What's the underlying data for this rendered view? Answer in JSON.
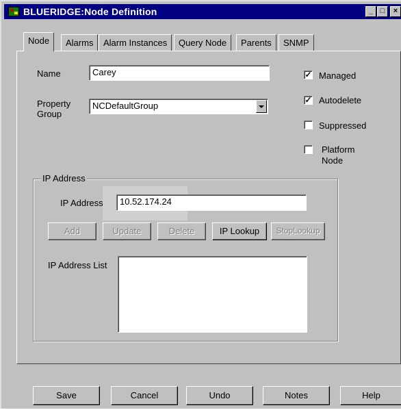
{
  "window": {
    "title": "BLUERIDGE:Node Definition",
    "controls": {
      "minimize": "_",
      "maximize": "□",
      "close": "×"
    }
  },
  "tabs": [
    {
      "label": "Node",
      "active": true
    },
    {
      "label": "Alarms"
    },
    {
      "label": "Alarm Instances"
    },
    {
      "label": "Query Node"
    },
    {
      "label": "Parents"
    },
    {
      "label": "SNMP"
    }
  ],
  "form": {
    "name_label": "Name",
    "name_value": "Carey",
    "property_group_label_line1": "Property",
    "property_group_label_line2": "Group",
    "property_group_value": "NCDefaultGroup"
  },
  "checkboxes": [
    {
      "label": "Managed",
      "checked": true
    },
    {
      "label": "Autodelete",
      "checked": true
    },
    {
      "label": "Suppressed",
      "checked": false
    },
    {
      "label_line1": "Platform",
      "label_line2": "Node",
      "checked": false
    }
  ],
  "ip_group": {
    "title": "IP Address",
    "ip_label": "IP Address",
    "ip_value": "10.52.174.24",
    "list_label": "IP Address List",
    "buttons": [
      {
        "label": "Add",
        "enabled": false
      },
      {
        "label": "Update",
        "enabled": false
      },
      {
        "label": "Delete",
        "enabled": false
      },
      {
        "label": "IP Lookup",
        "enabled": true
      },
      {
        "label": "StopLookup",
        "enabled": false
      }
    ]
  },
  "footer_buttons": [
    {
      "label": "Save"
    },
    {
      "label": "Cancel"
    },
    {
      "label": "Undo"
    },
    {
      "label": "Notes"
    },
    {
      "label": "Help"
    }
  ],
  "colors": {
    "titlebar": "#000080",
    "face": "#c0c0c0",
    "disabled_text": "#808080"
  }
}
